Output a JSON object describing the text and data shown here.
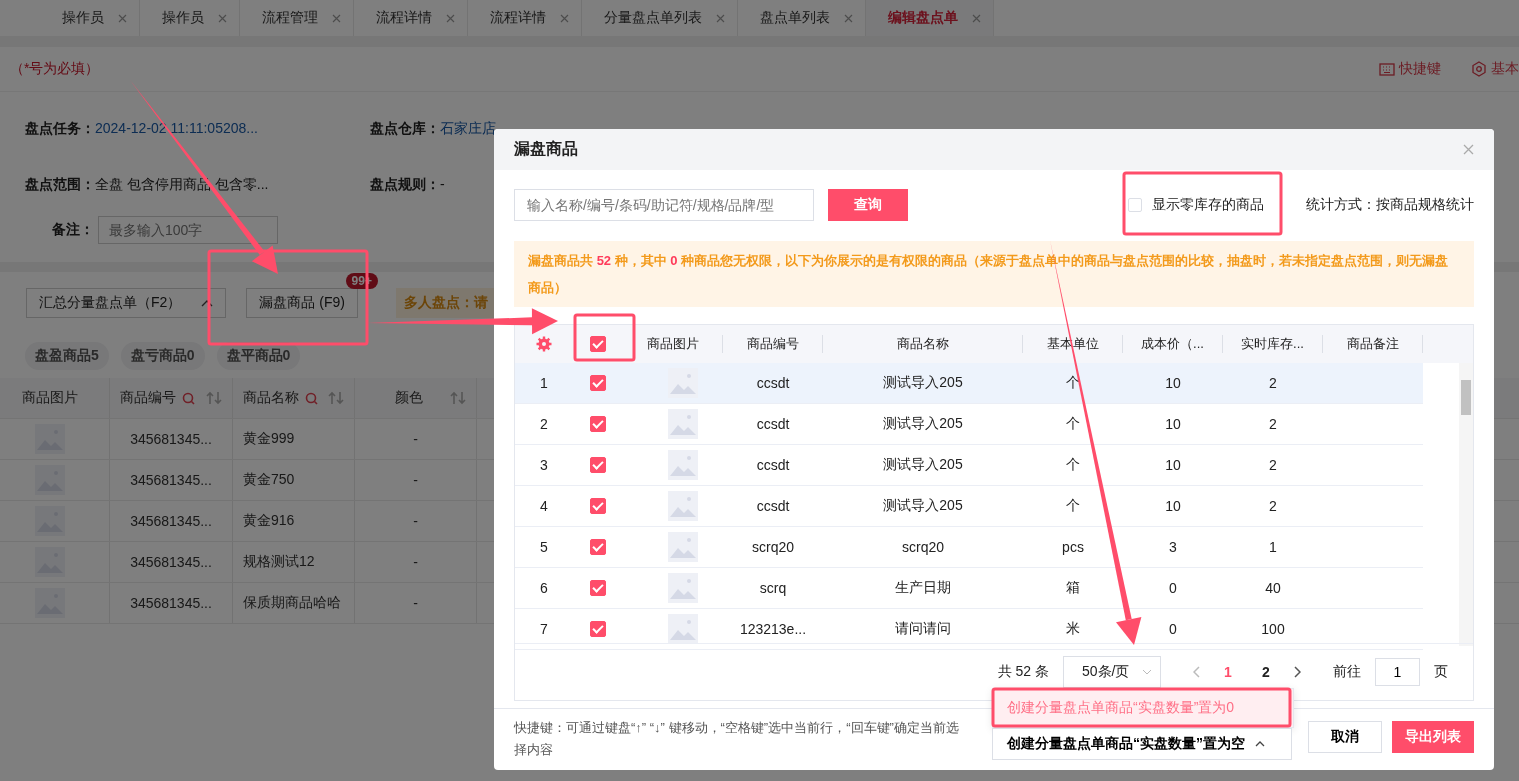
{
  "tabs": [
    {
      "label": "操作员",
      "selected": false
    },
    {
      "label": "操作员",
      "selected": false
    },
    {
      "label": "流程管理",
      "selected": false
    },
    {
      "label": "流程详情",
      "selected": false
    },
    {
      "label": "流程详情",
      "selected": false
    },
    {
      "label": "分量盘点单列表",
      "selected": false
    },
    {
      "label": "盘点单列表",
      "selected": false
    },
    {
      "label": "编辑盘点单",
      "selected": true
    }
  ],
  "page_header": {
    "required_note": "（*号为必填）",
    "shortcut_link": "快捷键",
    "basic_link": "基本"
  },
  "info_fields": [
    {
      "label": "盘点任务：",
      "value": "2024-12-02 11:11:05208...",
      "kind": "link"
    },
    {
      "label": "盘点仓库：",
      "value": "石家庄店",
      "kind": "link"
    },
    {
      "label": "盘点范围：",
      "value": "全盘 包含停用商品 包含零...",
      "kind": "text"
    },
    {
      "label": "盘点规则：",
      "value": "-",
      "kind": "text"
    }
  ],
  "remark": {
    "label": "备注：",
    "placeholder": "最多输入100字"
  },
  "toolbar": {
    "summary_button": "汇总分量盘点单（F2）",
    "missed_button": "漏盘商品 (F9)",
    "missed_badge": "99+",
    "multi_user_tag": "多人盘点：请"
  },
  "filter_chips": [
    "盘盈商品5",
    "盘亏商品0",
    "盘平商品0"
  ],
  "table": {
    "columns": [
      {
        "label": "商品图片",
        "kind": "plain"
      },
      {
        "label": "商品编号",
        "kind": "searchsort"
      },
      {
        "label": "商品名称",
        "kind": "searchsort"
      },
      {
        "label": "颜色",
        "kind": "sort"
      }
    ],
    "rows": [
      {
        "code": "345681345...",
        "name": "黄金999",
        "hue": "-"
      },
      {
        "code": "345681345...",
        "name": "黄金750",
        "hue": "-"
      },
      {
        "code": "345681345...",
        "name": "黄金916",
        "hue": "-"
      },
      {
        "code": "345681345...",
        "name": "规格测试12",
        "hue": "-"
      },
      {
        "code": "345681345...",
        "name": "保质期商品哈哈",
        "hue": "-"
      }
    ]
  },
  "dialog": {
    "title": "漏盘商品",
    "search": {
      "placeholder": "输入名称/编号/条码/助记符/规格/品牌/型"
    },
    "query_button": "查询",
    "show_zero_stock": {
      "label": "显示零库存的商品",
      "checked": false
    },
    "stat_mode": "统计方式：按商品规格统计",
    "notice": "漏盘商品共 **52** 种，其中 **0** 种商品您无权限，以下为你展示的是有权限的商品（来源于盘点单中的商品与盘点范围的比较，抽盘时，若未指定盘点范围，则无漏盘商品）",
    "table": {
      "select_all": true,
      "columns": [
        "商品图片",
        "商品编号",
        "商品名称",
        "基本单位",
        "成本价（...",
        "实时库存...",
        "商品备注"
      ],
      "rows": [
        {
          "index": "1",
          "checked": true,
          "selected": true,
          "code": "ccsdt",
          "name": "测试导入205",
          "unit": "个",
          "cost": "10",
          "stock": "2"
        },
        {
          "index": "2",
          "checked": true,
          "selected": false,
          "code": "ccsdt",
          "name": "测试导入205",
          "unit": "个",
          "cost": "10",
          "stock": "2"
        },
        {
          "index": "3",
          "checked": true,
          "selected": false,
          "code": "ccsdt",
          "name": "测试导入205",
          "unit": "个",
          "cost": "10",
          "stock": "2"
        },
        {
          "index": "4",
          "checked": true,
          "selected": false,
          "code": "ccsdt",
          "name": "测试导入205",
          "unit": "个",
          "cost": "10",
          "stock": "2"
        },
        {
          "index": "5",
          "checked": true,
          "selected": false,
          "code": "scrq20",
          "name": "scrq20",
          "unit": "pcs",
          "cost": "3",
          "stock": "1"
        },
        {
          "index": "6",
          "checked": true,
          "selected": false,
          "code": "scrq",
          "name": "生产日期",
          "unit": "箱",
          "cost": "0",
          "stock": "40"
        },
        {
          "index": "7",
          "checked": true,
          "selected": false,
          "code": "123213e...",
          "name": "请问请问",
          "unit": "米",
          "cost": "0",
          "stock": "100"
        }
      ]
    },
    "pagination": {
      "total": "共 52 条",
      "page_size": "50条/页",
      "pages": [
        {
          "label": "1",
          "selected": true
        },
        {
          "label": "2",
          "selected": false
        }
      ],
      "goto_label": "前往",
      "goto_value": "1",
      "page_suffix": "页"
    },
    "shortcut_hint": "快捷键：可通过键盘“↑” “↓” 键移动，“空格键”选中当前行，“回车键”确定当前选择内容",
    "menu_options": [
      {
        "label": "创建分量盘点单商品“实盘数量”置为0",
        "selected": true
      }
    ],
    "create_button": "创建分量盘点单商品“实盘数量”置为空",
    "cancel_button": "取消",
    "export_button": "导出列表"
  }
}
